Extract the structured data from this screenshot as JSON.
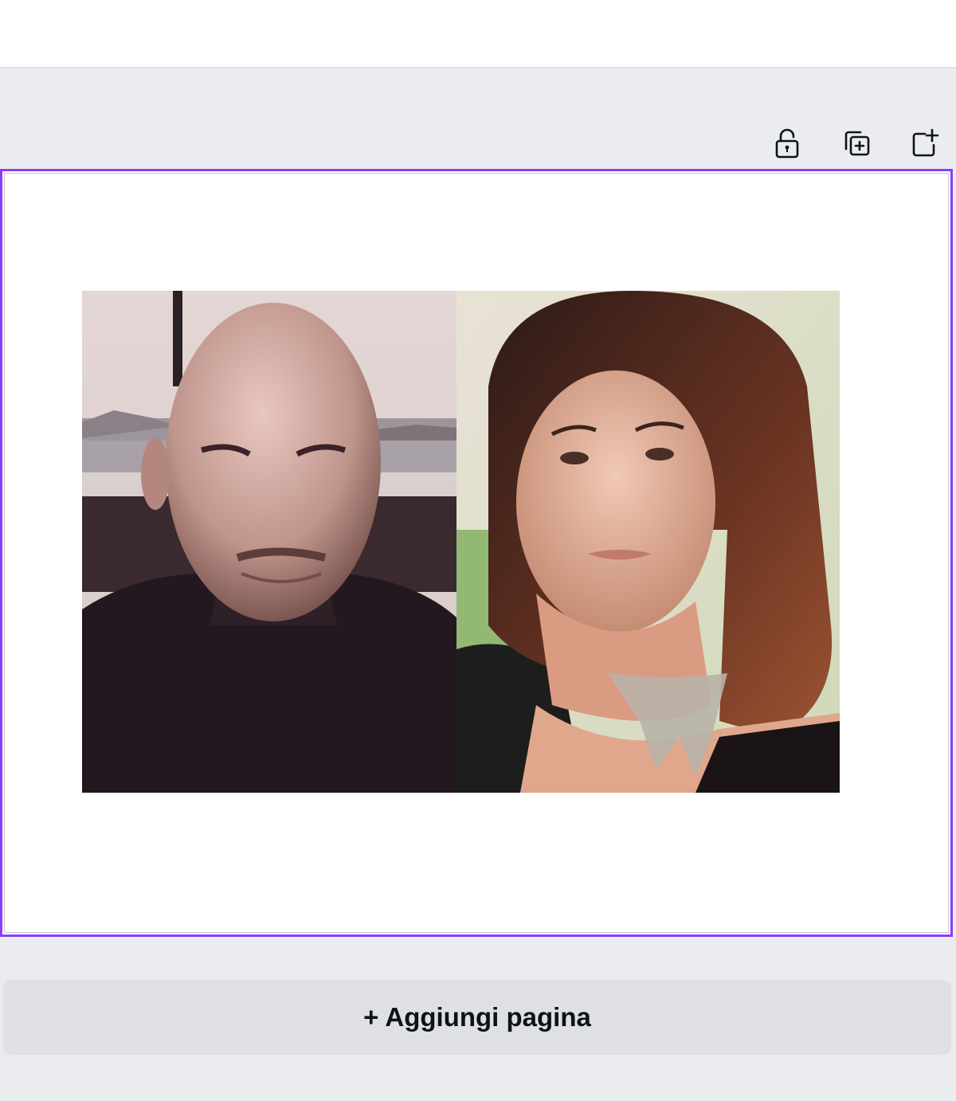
{
  "toolbar": {
    "lock_icon": "lock-open-icon",
    "duplicate_icon": "duplicate-page-icon",
    "add_icon": "add-page-icon"
  },
  "canvas": {
    "selection_color": "#8b3dff",
    "photos": [
      {
        "subject": "man-portrait"
      },
      {
        "subject": "woman-portrait"
      }
    ]
  },
  "footer": {
    "add_page_label": "+ Aggiungi pagina"
  }
}
